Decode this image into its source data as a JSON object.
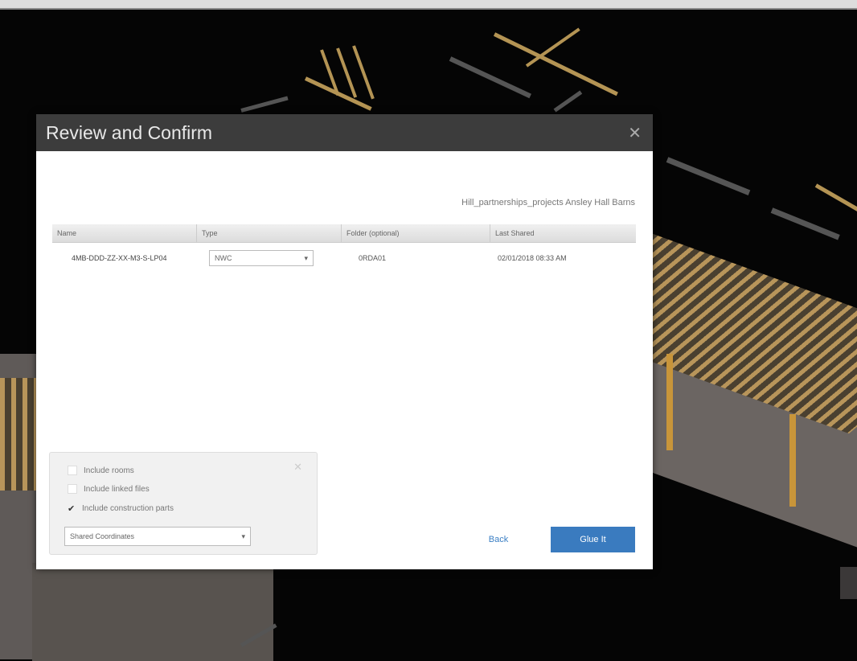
{
  "dialog": {
    "title": "Review and Confirm",
    "close_icon": "close-icon",
    "project_path": "Hill_partnerships_projects  Ansley Hall Barns"
  },
  "table": {
    "columns": [
      "Name",
      "Type",
      "Folder (optional)",
      "Last Shared"
    ],
    "rows": [
      {
        "name": "4MB-DDD-ZZ-XX-M3-S-LP04",
        "type": "NWC",
        "folder": "0RDA01",
        "last_shared": "02/01/2018 08:33 AM"
      }
    ]
  },
  "options": {
    "include_rooms": {
      "label": "Include rooms",
      "checked": false
    },
    "include_linked_files": {
      "label": "Include linked files",
      "checked": false
    },
    "include_construction_parts": {
      "label": "Include construction parts",
      "checked": true
    },
    "coordinates": "Shared Coordinates"
  },
  "buttons": {
    "back": "Back",
    "primary": "Glue It"
  },
  "colors": {
    "header_bg": "#3c3c3c",
    "primary_button": "#3a7bbf",
    "link_blue": "#3b7fc4"
  }
}
